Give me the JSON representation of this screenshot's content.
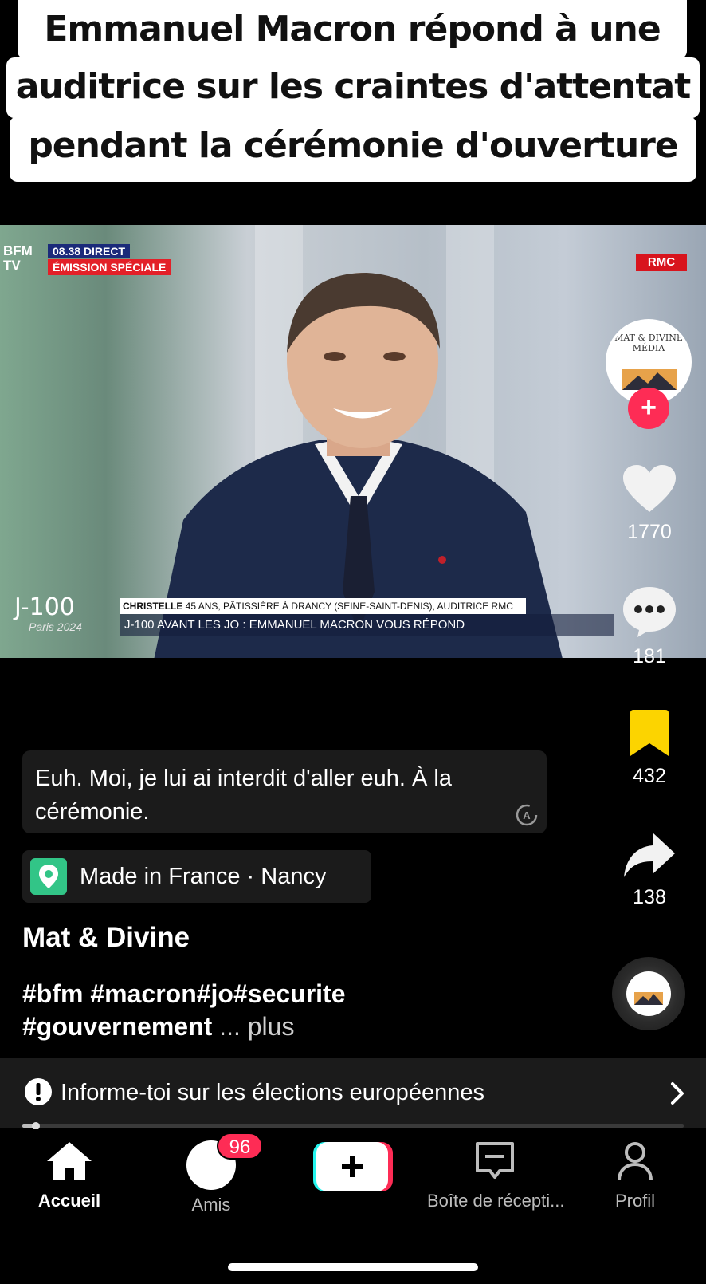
{
  "caption": {
    "line1": "Emmanuel Macron répond à une",
    "line2": "auditrice sur les craintes d'attentat",
    "line3": "pendant la cérémonie d'ouverture"
  },
  "video_overlay": {
    "channel_logo": "BFM TV",
    "time_direct": "08.38 DIRECT",
    "emission": "ÉMISSION SPÉCIALE",
    "rmc_tag": "RMC",
    "j100": "J-100",
    "paris": "Paris 2024",
    "lower_name_bold": "CHRISTELLE",
    "lower_name_rest": " 45 ANS, PÂTISSIÈRE À DRANCY (SEINE-SAINT-DENIS), AUDITRICE RMC",
    "lower_title": "J-100 AVANT LES JO : EMMANUEL MACRON VOUS RÉPOND"
  },
  "account": {
    "avatar_text": "MAT & DIVINE MÉDIA"
  },
  "actions": {
    "likes": "1770",
    "comments": "181",
    "saves": "432",
    "shares": "138"
  },
  "subtitle": "Euh. Moi, je lui ai interdit d'aller euh. À la cérémonie.",
  "location": "Made in France · Nancy",
  "author": "Mat & Divine",
  "hashtags_line1": "#bfm #macron#jo#securite",
  "hashtags_line2": "#gouvernement",
  "more_label": "... plus",
  "banner_text": "Informe-toi sur les élections européennes",
  "progress": 0.02,
  "nav": {
    "home": "Accueil",
    "friends": "Amis",
    "friends_badge": "96",
    "inbox": "Boîte de récepti...",
    "profile": "Profil"
  },
  "colors": {
    "accent": "#fe2c55",
    "bookmark": "#fcd400",
    "location_icon": "#32c587"
  }
}
